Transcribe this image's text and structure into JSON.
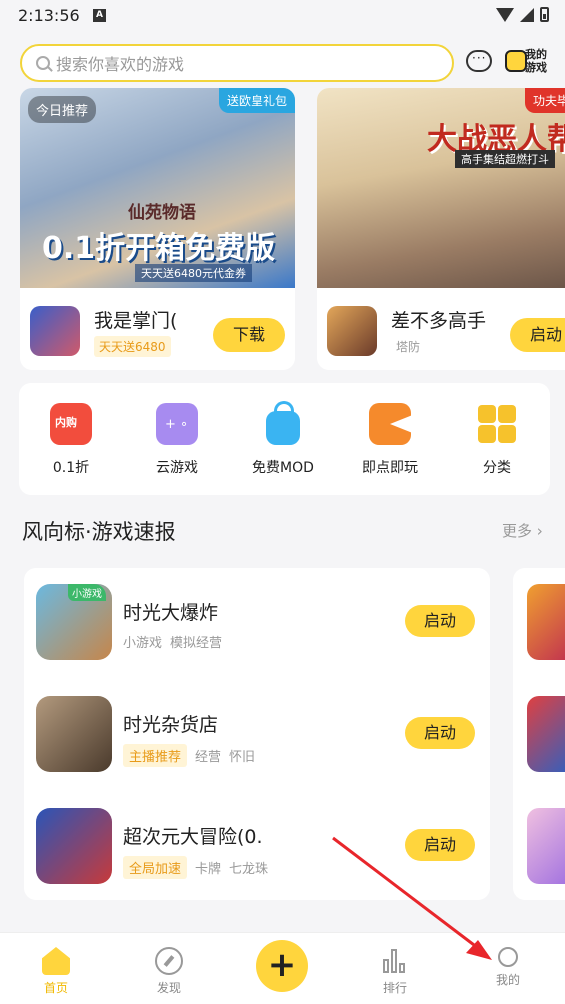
{
  "status": {
    "time": "2:13:56",
    "notif_icon": "A"
  },
  "header": {
    "search_placeholder": "搜索你喜欢的游戏",
    "mygame_label_1": "我的",
    "mygame_label_2": "游戏"
  },
  "featured": [
    {
      "badge": "今日推荐",
      "corner": "送欧皇礼包",
      "banner_logo": "仙苑物语",
      "banner_title": "0.1折开箱免费版",
      "banner_sub": "天天送6480元代金券",
      "name": "我是掌门(",
      "tag": "天天送6480",
      "button": "下载"
    },
    {
      "corner": "功夫毕",
      "banner_title": "大战恶人帮",
      "banner_sub": "高手集结超燃打斗",
      "name": "差不多高手",
      "tag": "塔防",
      "button": "启动"
    }
  ],
  "categories": [
    {
      "label": "0.1折",
      "icon_text": "内购",
      "icon": "ticket-icon"
    },
    {
      "label": "云游戏",
      "icon": "cloud-gamepad-icon"
    },
    {
      "label": "免费MOD",
      "icon": "lock-icon"
    },
    {
      "label": "即点即玩",
      "icon": "pacman-icon"
    },
    {
      "label": "分类",
      "icon": "grid-icon"
    }
  ],
  "section": {
    "title": "风向标·游戏速报",
    "more": "更多"
  },
  "games": [
    {
      "name": "时光大爆炸",
      "icon_tag": "小游戏",
      "tags": [
        "小游戏",
        "模拟经营"
      ],
      "highlight": "",
      "button": "启动"
    },
    {
      "name": "时光杂货店",
      "tags": [
        "经营",
        "怀旧"
      ],
      "highlight": "主播推荐",
      "button": "启动"
    },
    {
      "name": "超次元大冒险(0.",
      "tags": [
        "卡牌",
        "七龙珠"
      ],
      "highlight": "全局加速",
      "button": "启动"
    }
  ],
  "tabbar": [
    {
      "label": "首页"
    },
    {
      "label": "发现"
    },
    {
      "label": "+"
    },
    {
      "label": "排行"
    },
    {
      "label": "我的"
    }
  ],
  "colors": {
    "accent": "#ffd53d",
    "annotation_arrow": "#e8262b"
  }
}
